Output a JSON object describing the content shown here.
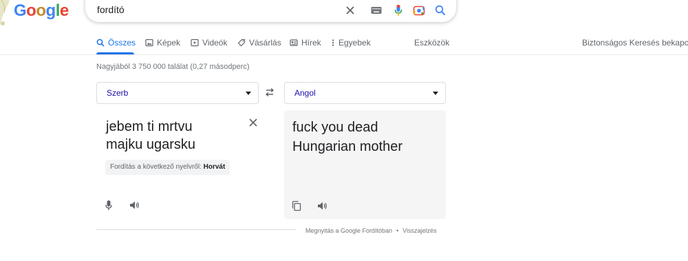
{
  "header": {
    "logo_letters": [
      "G",
      "o",
      "o",
      "g",
      "l",
      "e"
    ],
    "search": {
      "query": "fordító",
      "icons": [
        "close-icon",
        "keyboard-icon",
        "microphone-icon",
        "lens-camera-icon",
        "search-icon"
      ]
    }
  },
  "tabs": {
    "items": [
      {
        "label": "Összes",
        "icon": "search-icon",
        "active": true
      },
      {
        "label": "Képek",
        "icon": "image-icon"
      },
      {
        "label": "Videók",
        "icon": "video-icon"
      },
      {
        "label": "Vásárlás",
        "icon": "tag-icon"
      },
      {
        "label": "Hírek",
        "icon": "news-icon"
      },
      {
        "label": "Egyebek",
        "icon": "more-vertical-icon"
      }
    ],
    "tools": "Eszközök",
    "safesearch": "Biztonságos Keresés bekapcsolva"
  },
  "result_stats": "Nagyjából 3 750 000 találat (0,27 másodperc)",
  "translator": {
    "source_language": "Szerb",
    "target_language": "Angol",
    "source_lines": [
      "jebem ti mrtvu",
      "majku ugarsku"
    ],
    "detected_prefix": "Fordítás a következő nyelvről:",
    "detected_language": "Horvát",
    "target_lines": [
      "fuck you dead",
      "Hungarian mother"
    ],
    "footer": {
      "open_link": "Megnyitás a Google Fordítóban",
      "separator": "•",
      "feedback_link": "Visszajelzés"
    }
  },
  "colors": {
    "accent": "#1a73e8",
    "link": "#1a0dab",
    "muted": "#70757a",
    "target_panel_bg": "#f5f5f5"
  }
}
